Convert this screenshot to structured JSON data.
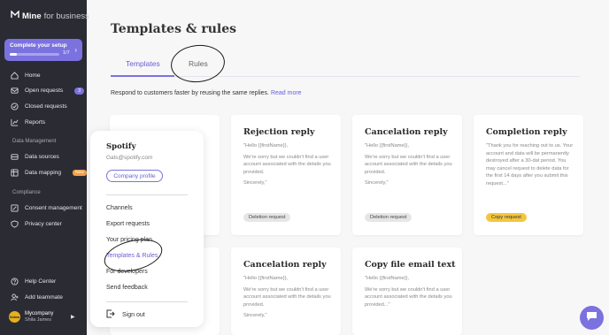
{
  "brand": {
    "bold": "Mine",
    "light": "for business"
  },
  "setup": {
    "title": "Complete your setup",
    "progress_label": "1/7",
    "progress": 0.14
  },
  "nav": {
    "home": "Home",
    "open_requests": "Open requests",
    "open_requests_count": "3",
    "closed_requests": "Closed requests",
    "reports": "Reports",
    "data_management_title": "Data Management",
    "data_sources": "Data sources",
    "data_mapping": "Data mapping",
    "data_mapping_badge": "New",
    "compliance_title": "Compliance",
    "consent_management": "Consent management",
    "privacy_center": "Privacy center",
    "help_center": "Help Center",
    "add_teammate": "Add teammate"
  },
  "account": {
    "company": "Mycompany",
    "user": "Shila James",
    "logo_text": "Nutma"
  },
  "page": {
    "title": "Templates & rules",
    "tabs": {
      "templates": "Templates",
      "rules": "Rules"
    },
    "description": "Respond to customers faster by reusing the same replies.",
    "read_more": "Read more"
  },
  "cards": [
    {
      "title": "Rejection reply",
      "greeting": "\"Hello {{firstName}},",
      "body": "We're sorry but we couldn't find a user account associated with the details you provided.",
      "closing": "Sincerely,\"",
      "tag": "Deletion request",
      "tag_color": "#e6e6e6"
    },
    {
      "title": "Cancelation reply",
      "greeting": "\"Hello {{firstName}},",
      "body": "We're sorry but we couldn't find a user account associated with the details you provided.",
      "closing": "Sincerely,\"",
      "tag": "Deletion request",
      "tag_color": "#e6e6e6"
    },
    {
      "title": "Completion reply",
      "body": "\"Thank you for reaching out to us. Your account and data will be permanently destroyed after a 30-dat period. You may cancel request to delete data for the first 14 days after you submit this request...\"",
      "tag": "Copy request",
      "tag_color": "#f3c63f"
    },
    {
      "title": "Cancelation reply",
      "greeting": "\"Hello {{firstName}},",
      "body": "We're sorry but we couldn't find a user account associated with the details you provided.",
      "closing": "Sincerely,\""
    },
    {
      "title": "Copy file email text",
      "greeting": "\"Hello {{firstName}},",
      "body": "We're sorry but we couldn't find a user account associated with the details you provided...\""
    }
  ],
  "menu": {
    "company": "Spotify",
    "email": "Gals@spotify.com",
    "profile_button": "Company profile",
    "items": [
      "Channels",
      "Export requests",
      "Your pricing plan",
      "Templates & Rules",
      "For developers",
      "Send feedback"
    ],
    "sign_out": "Sign out"
  },
  "colors": {
    "accent": "#7b72e0",
    "sidebar": "#2b2b33",
    "copy_tag": "#f3c63f"
  }
}
